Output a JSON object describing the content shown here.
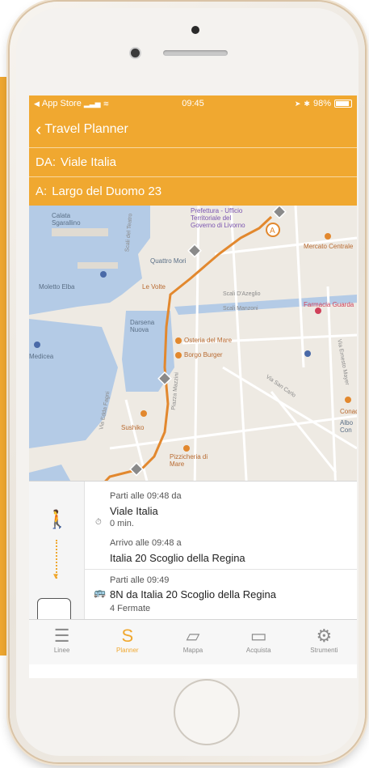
{
  "statusbar": {
    "carrier": "App Store",
    "time": "09:45",
    "battery": "98%"
  },
  "nav": {
    "back_label": "Travel Planner"
  },
  "route": {
    "from_prefix": "DA:",
    "from_value": "Viale Italia",
    "to_prefix": "A:",
    "to_value": "Largo del Duomo 23"
  },
  "map": {
    "labels": [
      "Calata Sgarallino",
      "Prefettura - Ufficio Territoriale del Governo di Livorno",
      "Mercato Centrale",
      "Quattro Mori",
      "Moletto Elba",
      "Le Volte",
      "Scali D'Azeglio",
      "Scali Manzoni",
      "Farmacia Guarda",
      "Darsena Nuova",
      "Osteria del Mare",
      "Borgo Burger",
      "Medicea",
      "Sushiko",
      "Pizzicheria di Mare",
      "Conad",
      "Albo Con",
      "Via San Carlo",
      "Via Edda Fagni",
      "Piazza Mazzini",
      "Via Ernesto Mayer",
      "Scali del Teatro"
    ],
    "marker_label": "A"
  },
  "steps": {
    "walk_depart": "Parti alle 09:48 da",
    "walk_from": "Viale Italia",
    "walk_duration": "0 min.",
    "walk_arrive": "Arrivo alle 09:48 a",
    "walk_to": "Italia 20 Scoglio della Regina",
    "bus_depart": "Parti alle 09:49",
    "bus_line": "8N  da Italia 20 Scoglio della Regina",
    "bus_stops": "4 Fermate"
  },
  "tabs": [
    {
      "label": "Linee",
      "icon": "list-icon"
    },
    {
      "label": "Planner",
      "icon": "route-icon"
    },
    {
      "label": "Mappa",
      "icon": "map-icon"
    },
    {
      "label": "Acquista",
      "icon": "ticket-icon"
    },
    {
      "label": "Strumenti",
      "icon": "gear-icon"
    }
  ],
  "colors": {
    "accent": "#f0a830",
    "route_line": "#e2882e",
    "water": "#b4cbe6"
  }
}
